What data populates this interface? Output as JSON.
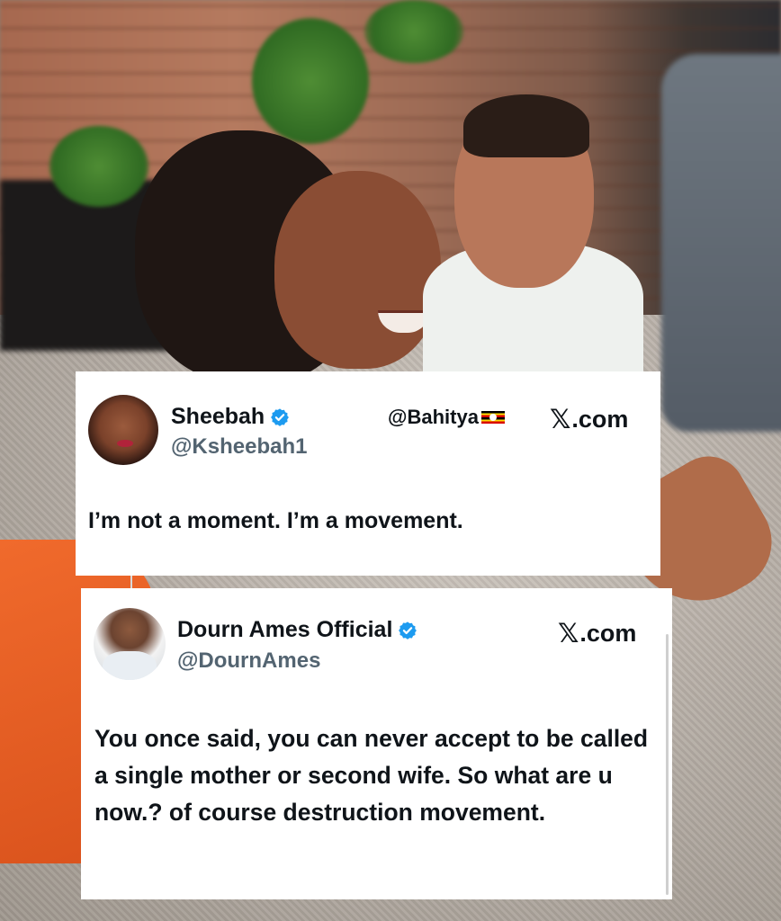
{
  "tweets": [
    {
      "display_name": "Sheebah",
      "handle": "@Ksheebah1",
      "verified": true,
      "watermark": "@Bahitya",
      "watermark_flag": "uganda-flag-emoji",
      "source_logo": "𝕏",
      "source_text": ".com",
      "text": "I’m not a moment. I’m a movement."
    },
    {
      "display_name": "Dourn Ames Official",
      "handle": "@DournAmes",
      "verified": true,
      "source_logo": "𝕏",
      "source_text": ".com",
      "text": "You once said, you can never accept to be called a single mother or second wife. So what are u now.?  of course destruction movement."
    }
  ],
  "colors": {
    "text_primary": "#0f1419",
    "text_secondary": "#536471",
    "verified_blue": "#1d9bf0",
    "card_bg": "#ffffff",
    "dress_orange": "#f06a2c"
  },
  "icons": [
    "verified-badge-icon",
    "x-logo-icon",
    "uganda-flag-icon"
  ]
}
